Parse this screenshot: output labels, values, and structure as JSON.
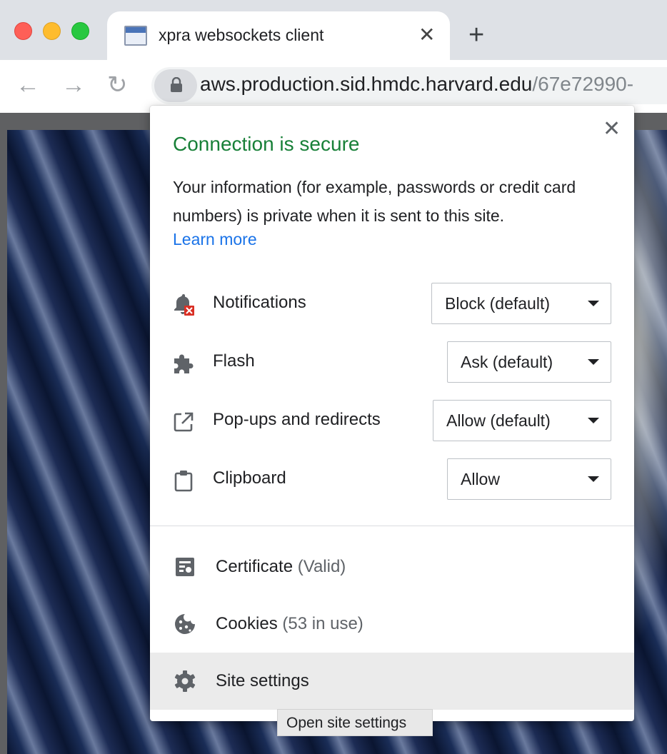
{
  "tab": {
    "title": "xpra websockets client",
    "close_glyph": "✕"
  },
  "newtab_glyph": "+",
  "toolbar": {
    "back_glyph": "←",
    "forward_glyph": "→",
    "reload_glyph": "↻"
  },
  "omnibox": {
    "host": "aws.production.sid.hmdc.harvard.edu",
    "path": "/67e72990-"
  },
  "popup": {
    "close_glyph": "✕",
    "title": "Connection is secure",
    "description": "Your information (for example, passwords or credit card numbers) is private when it is sent to this site.",
    "learn_more": "Learn more",
    "permissions": [
      {
        "label": "Notifications",
        "value": "Block (default)",
        "icon": "notifications-blocked-icon"
      },
      {
        "label": "Flash",
        "value": "Ask (default)",
        "icon": "puzzle-icon"
      },
      {
        "label": "Pop-ups and redirects",
        "value": "Allow (default)",
        "icon": "open-external-icon"
      },
      {
        "label": "Clipboard",
        "value": "Allow",
        "icon": "clipboard-icon"
      }
    ],
    "certificate": {
      "label": "Certificate",
      "status": "(Valid)"
    },
    "cookies": {
      "label": "Cookies",
      "status": "(53 in use)"
    },
    "site_settings": {
      "label": "Site settings"
    }
  },
  "tooltip": "Open site settings",
  "colors": {
    "secure_green": "#188038",
    "link_blue": "#1a73e8",
    "hover_row": "#ebebeb"
  }
}
